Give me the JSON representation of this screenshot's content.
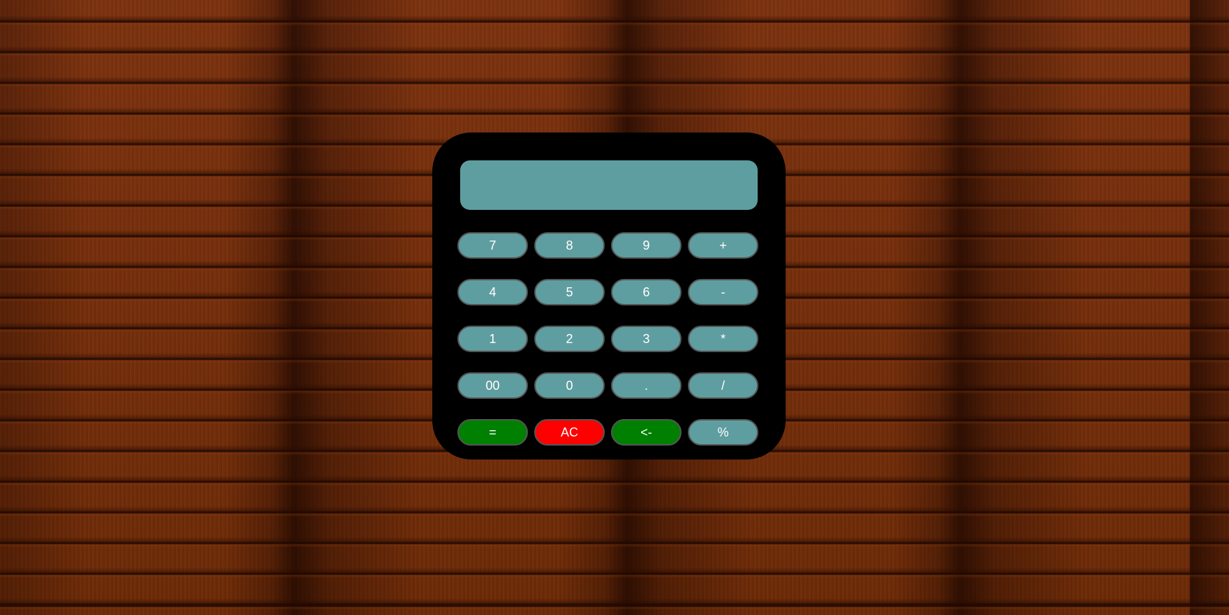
{
  "calculator": {
    "display_value": "",
    "rows": [
      [
        {
          "label": "7",
          "name": "key-7",
          "color": "teal"
        },
        {
          "label": "8",
          "name": "key-8",
          "color": "teal"
        },
        {
          "label": "9",
          "name": "key-9",
          "color": "teal"
        },
        {
          "label": "+",
          "name": "add-button",
          "color": "teal"
        }
      ],
      [
        {
          "label": "4",
          "name": "key-4",
          "color": "teal"
        },
        {
          "label": "5",
          "name": "key-5",
          "color": "teal"
        },
        {
          "label": "6",
          "name": "key-6",
          "color": "teal"
        },
        {
          "label": "-",
          "name": "subtract-button",
          "color": "teal"
        }
      ],
      [
        {
          "label": "1",
          "name": "key-1",
          "color": "teal"
        },
        {
          "label": "2",
          "name": "key-2",
          "color": "teal"
        },
        {
          "label": "3",
          "name": "key-3",
          "color": "teal"
        },
        {
          "label": "*",
          "name": "multiply-button",
          "color": "teal"
        }
      ],
      [
        {
          "label": "00",
          "name": "key-00",
          "color": "teal"
        },
        {
          "label": "0",
          "name": "key-0",
          "color": "teal"
        },
        {
          "label": ".",
          "name": "decimal-button",
          "color": "teal"
        },
        {
          "label": "/",
          "name": "divide-button",
          "color": "teal"
        }
      ],
      [
        {
          "label": "=",
          "name": "equals-button",
          "color": "green"
        },
        {
          "label": "AC",
          "name": "all-clear-button",
          "color": "red"
        },
        {
          "label": "<-",
          "name": "backspace-button",
          "color": "green"
        },
        {
          "label": "%",
          "name": "percent-button",
          "color": "teal"
        }
      ]
    ]
  },
  "colors": {
    "body": "#000000",
    "display": "#5f9ea0",
    "teal_key": "#5f9ea0",
    "green_key": "#008000",
    "red_key": "#ff0000",
    "key_text": "#ffffff"
  }
}
